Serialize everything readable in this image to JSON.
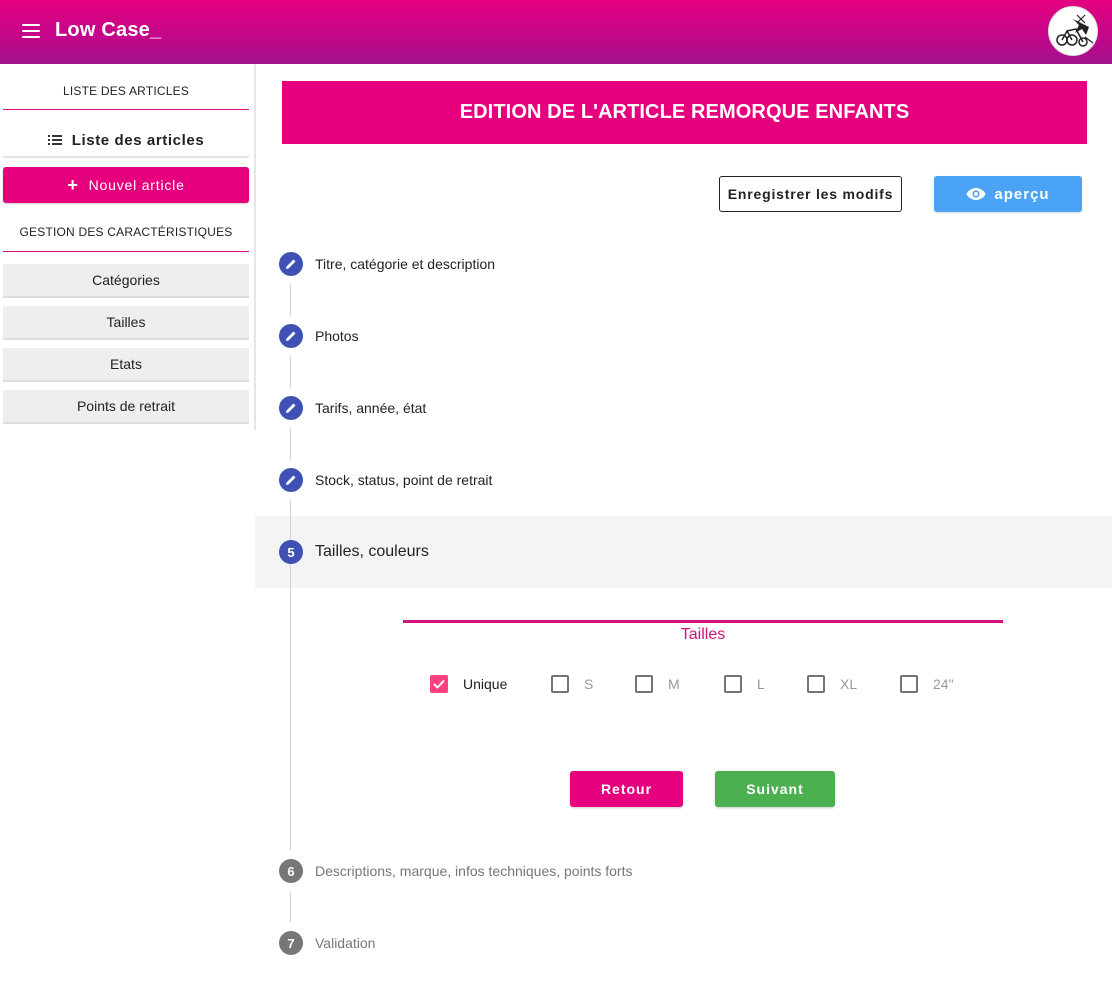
{
  "app": {
    "title": "Low Case_"
  },
  "sidebar": {
    "section_articles": "LISTE DES ARTICLES",
    "articles_list_label": "Liste des articles",
    "new_article_label": "Nouvel article",
    "section_characteristics": "GESTION DES CARACTÉRISTIQUES",
    "items": [
      {
        "label": "Catégories"
      },
      {
        "label": "Tailles"
      },
      {
        "label": "Etats"
      },
      {
        "label": "Points de retrait"
      }
    ]
  },
  "main": {
    "banner_title": "EDITION DE L'ARTICLE REMORQUE ENFANTS",
    "save_label": "Enregistrer les modifs",
    "preview_label": "aperçu"
  },
  "steps": [
    {
      "label": "Titre, catégorie et description",
      "state": "done",
      "icon": "pencil-icon"
    },
    {
      "label": "Photos",
      "state": "done",
      "icon": "pencil-icon"
    },
    {
      "label": "Tarifs, année, état",
      "state": "done",
      "icon": "pencil-icon"
    },
    {
      "label": "Stock, status, point de retrait",
      "state": "done",
      "icon": "pencil-icon"
    },
    {
      "number": "5",
      "label": "Tailles, couleurs",
      "state": "active"
    },
    {
      "number": "6",
      "label": "Descriptions, marque, infos techniques, points forts",
      "state": "todo"
    },
    {
      "number": "7",
      "label": "Validation",
      "state": "todo"
    }
  ],
  "sizes": {
    "title": "Tailles",
    "options": [
      {
        "label": "Unique",
        "checked": true
      },
      {
        "label": "S",
        "checked": false
      },
      {
        "label": "M",
        "checked": false
      },
      {
        "label": "L",
        "checked": false
      },
      {
        "label": "XL",
        "checked": false
      },
      {
        "label": "24\"",
        "checked": false
      }
    ]
  },
  "actions": {
    "back_label": "Retour",
    "next_label": "Suivant"
  },
  "colors": {
    "brand_pink": "#e6007e",
    "step_blue": "#3f51b5",
    "preview_blue": "#4aa3f5",
    "next_green": "#4caf50",
    "checkbox_pink": "#ff4081"
  }
}
